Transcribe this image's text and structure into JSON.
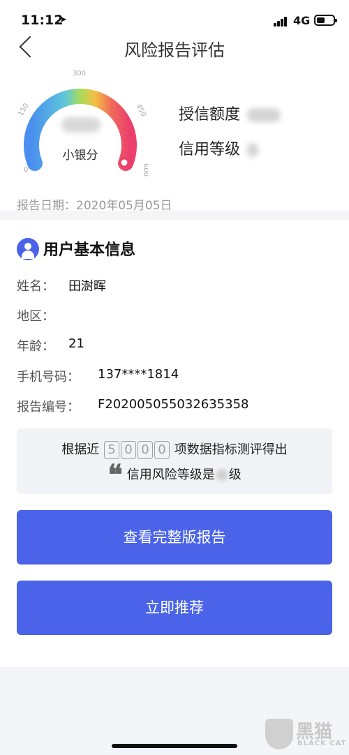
{
  "status_bar": {
    "time": "11:12",
    "network": "4G"
  },
  "header": {
    "title": "风险报告评估"
  },
  "gauge": {
    "ticks": [
      "0",
      "150",
      "300",
      "450",
      "600"
    ],
    "label": "小银分"
  },
  "credit": {
    "limit_label": "授信额度",
    "level_label": "信用等级"
  },
  "report_date": "报告日期：2020年05月05日",
  "basic_info": {
    "title": "用户基本信息",
    "fields": [
      {
        "label": "姓名：",
        "value": "田澍晖"
      },
      {
        "label": "地区：",
        "value": ""
      },
      {
        "label": "年龄：",
        "value": "21"
      },
      {
        "label": "手机号码：",
        "value": "137****1814"
      },
      {
        "label": "报告编号：",
        "value": "F202005055032635358"
      }
    ]
  },
  "summary": {
    "prefix": "根据近",
    "digits": [
      "5",
      "0",
      "0",
      "0"
    ],
    "suffix": "项数据指标测评得出",
    "line2_prefix": "信用风险等级是",
    "line2_suffix": "级"
  },
  "buttons": {
    "full_report": "查看完整版报告",
    "recommend": "立即推荐"
  },
  "watermark": {
    "text": "黑猫",
    "sub": "BLACK CAT"
  },
  "colors": {
    "accent": "#4a63e8",
    "background": "#f4f5f9"
  }
}
